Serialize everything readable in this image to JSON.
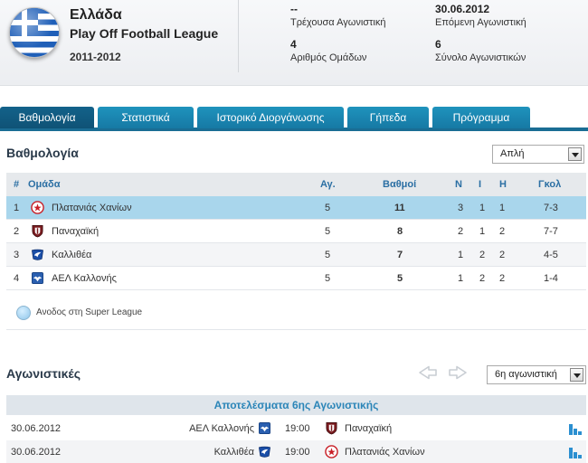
{
  "header": {
    "country": "Ελλάδα",
    "league": "Play Off Football League",
    "season": "2011-2012",
    "current_round_value": "--",
    "current_round_label": "Τρέχουσα Αγωνιστική",
    "next_round_value": "30.06.2012",
    "next_round_label": "Επόμενη Αγωνιστική",
    "teams_value": "4",
    "teams_label": "Αριθμός Ομάδων",
    "rounds_value": "6",
    "rounds_label": "Σύνολο Αγωνιστικών",
    "flag_icon": "greece-flag-icon"
  },
  "tabs": [
    {
      "label": "Βαθμολογία",
      "active": true
    },
    {
      "label": "Στατιστικά",
      "active": false
    },
    {
      "label": "Ιστορικό Διοργάνωσης",
      "active": false
    },
    {
      "label": "Γήπεδα",
      "active": false
    },
    {
      "label": "Πρόγραμμα",
      "active": false
    }
  ],
  "standings": {
    "title": "Βαθμολογία",
    "view_select": "Απλή",
    "columns": {
      "pos": "#",
      "team": "Ομάδα",
      "played": "Αγ.",
      "points": "Βαθμοί",
      "won": "Ν",
      "drawn": "Ι",
      "lost": "Η",
      "goals": "Γκολ"
    },
    "rows": [
      {
        "pos": "1",
        "team": "Πλατανιάς Χανίων",
        "played": "5",
        "points": "11",
        "won": "3",
        "drawn": "1",
        "lost": "1",
        "goals": "7-3",
        "crest": "red-star-crest"
      },
      {
        "pos": "2",
        "team": "Παναχαϊκή",
        "played": "5",
        "points": "8",
        "won": "2",
        "drawn": "1",
        "lost": "2",
        "goals": "7-7",
        "crest": "maroon-shield-crest"
      },
      {
        "pos": "3",
        "team": "Καλλιθέα",
        "played": "5",
        "points": "7",
        "won": "1",
        "drawn": "2",
        "lost": "2",
        "goals": "4-5",
        "crest": "blue-bird-crest"
      },
      {
        "pos": "4",
        "team": "ΑΕΛ Καλλονής",
        "played": "5",
        "points": "5",
        "won": "1",
        "drawn": "2",
        "lost": "2",
        "goals": "1-4",
        "crest": "blue-eagle-crest"
      }
    ],
    "legend": "Ανοδος στη Super League"
  },
  "fixtures": {
    "title": "Αγωνιστικές",
    "round_select": "6η αγωνιστική",
    "results_header": "Αποτελέσματα 6ης Αγωνιστικής",
    "matches": [
      {
        "date": "30.06.2012",
        "home": "ΑΕΛ Καλλονής",
        "time": "19:00",
        "away": "Παναχαϊκή"
      },
      {
        "date": "30.06.2012",
        "home": "Καλλιθέα",
        "time": "19:00",
        "away": "Πλατανιάς Χανίων"
      }
    ]
  },
  "colors": {
    "tab": "#1a84b1",
    "tab_active": "#0f5276",
    "highlight_row": "#a9d6ec",
    "header_text": "#2b6fa3"
  }
}
